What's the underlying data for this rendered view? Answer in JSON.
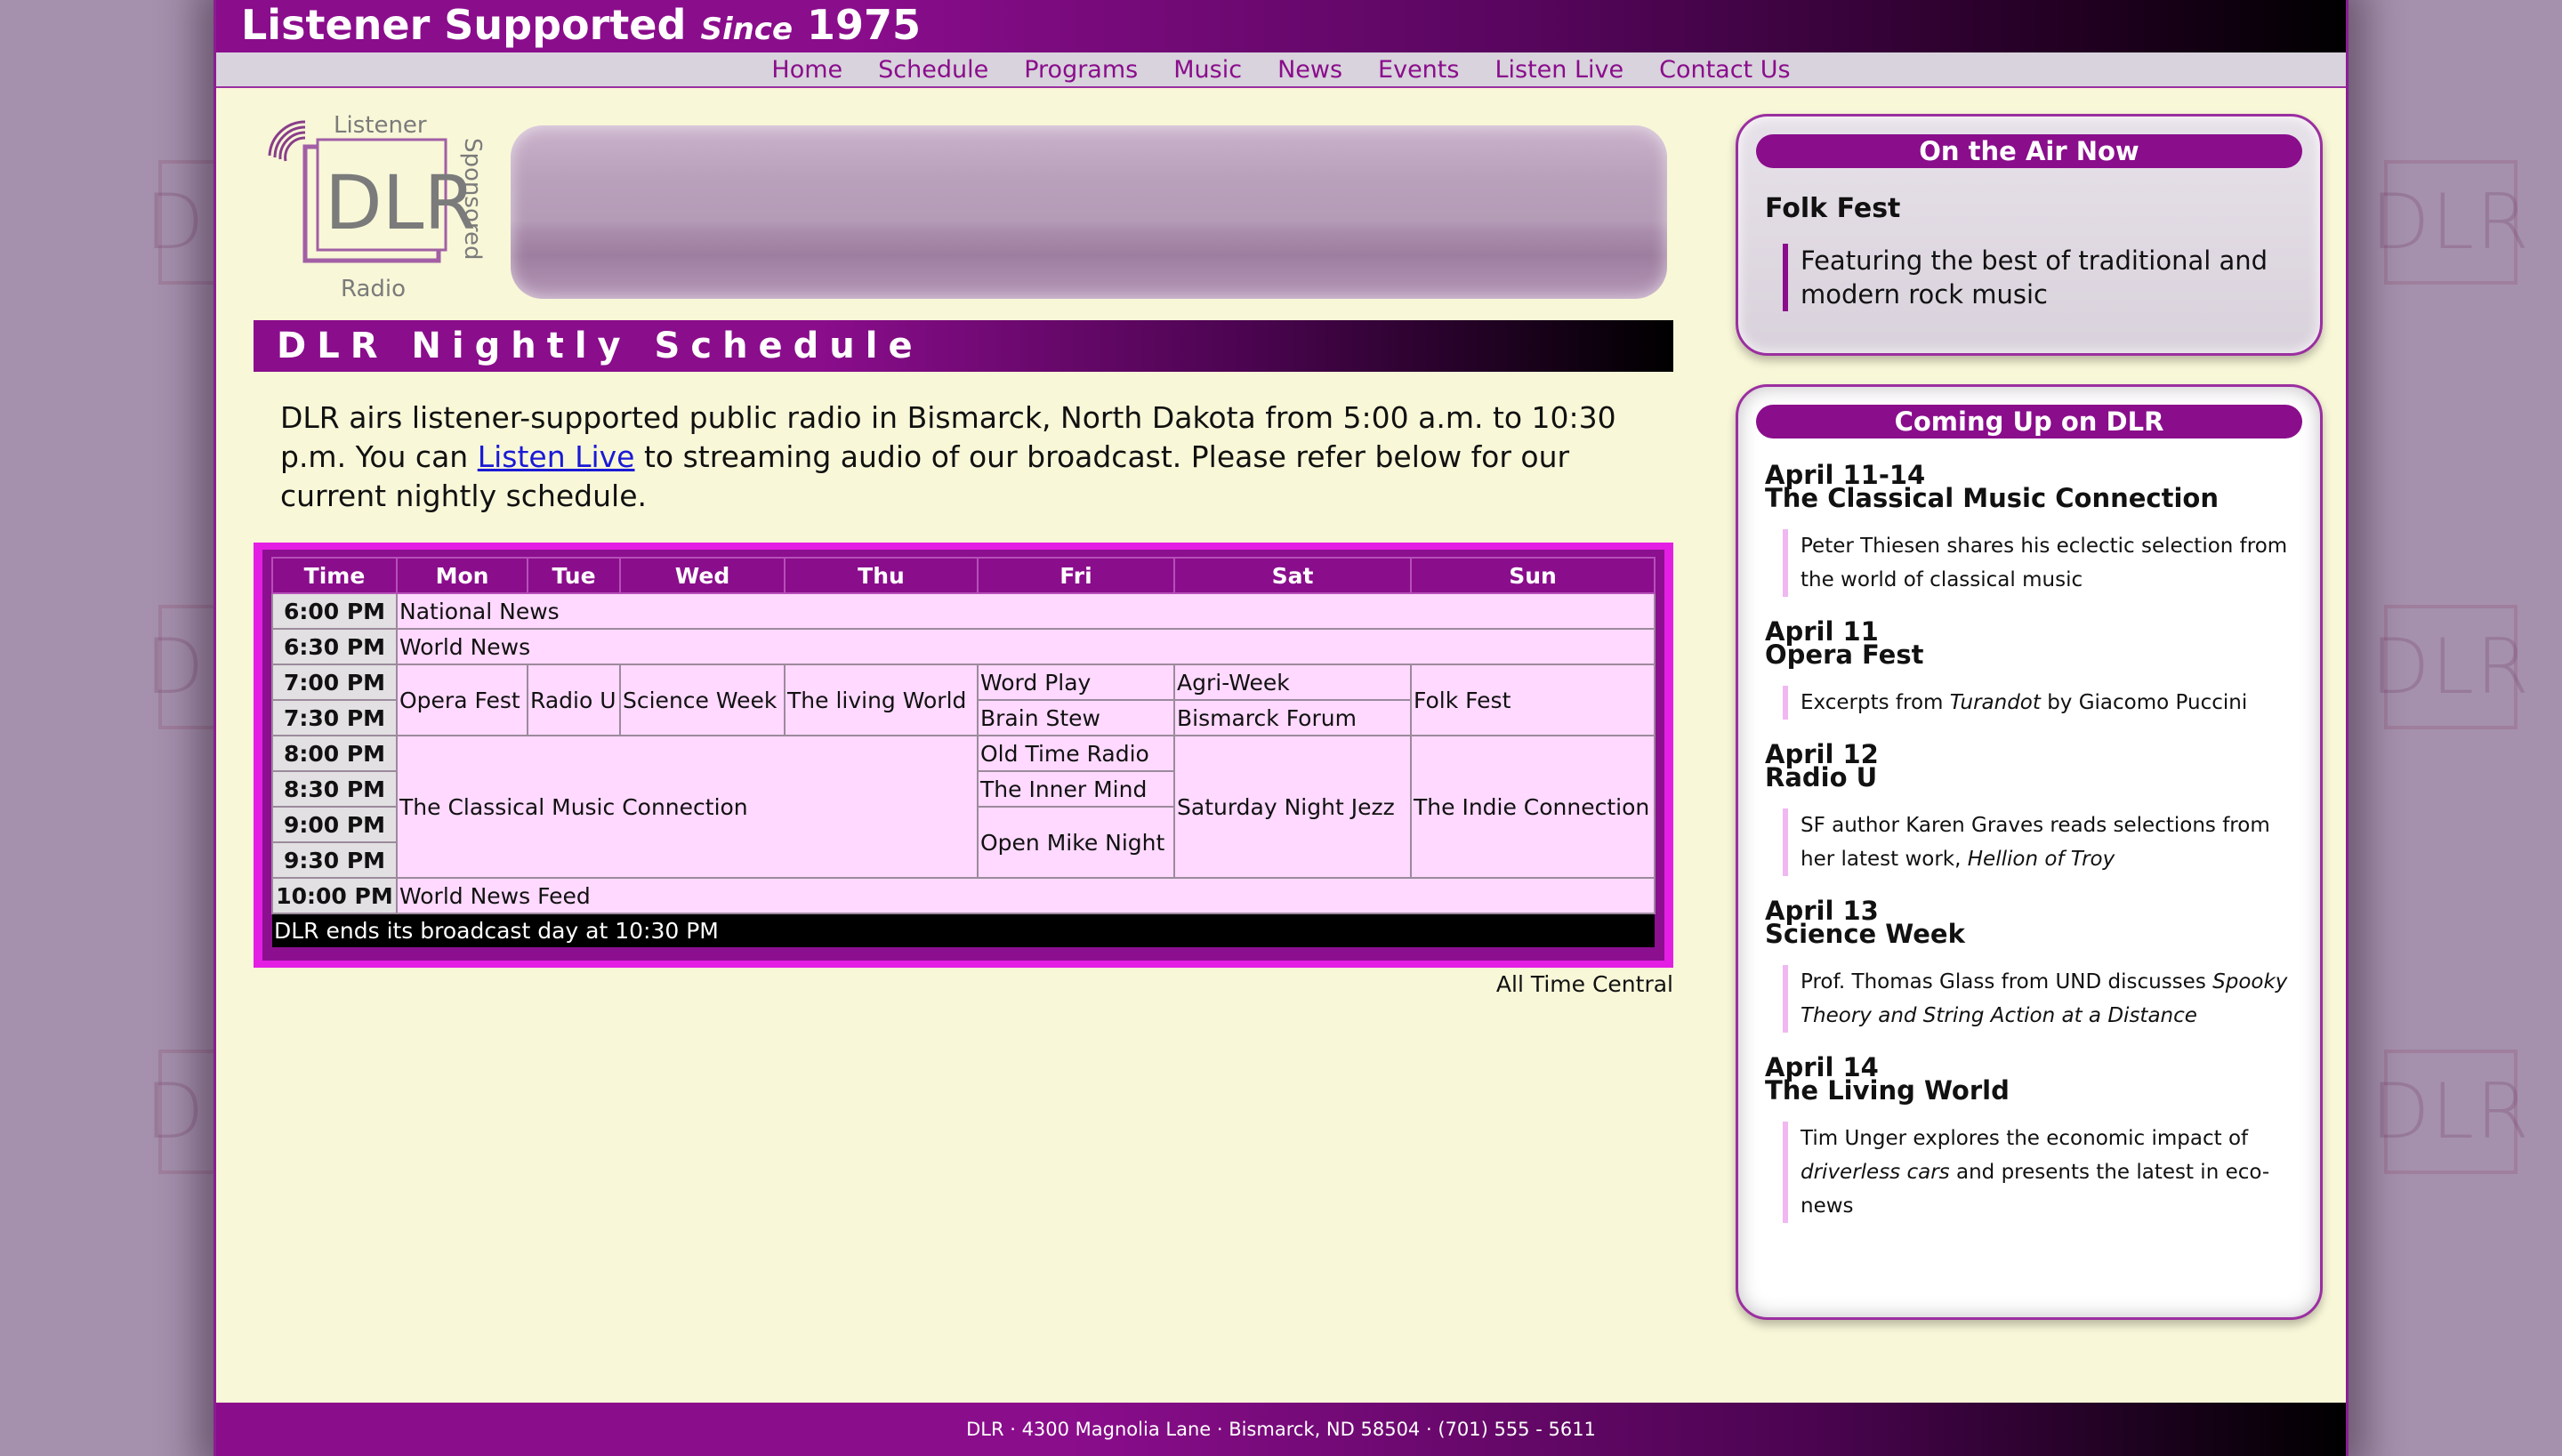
{
  "masthead": {
    "part1": "Listener Supported",
    "since": "Since",
    "year": "1975"
  },
  "nav": [
    "Home",
    "Schedule",
    "Programs",
    "Music",
    "News",
    "Events",
    "Listen Live",
    "Contact Us"
  ],
  "logo": {
    "listener": "Listener",
    "dlr": "DLR",
    "sponsored": "Sponsored",
    "radio": "Radio"
  },
  "schedule_title": "DLR Nightly Schedule",
  "intro": {
    "before": "DLR airs listener-supported public radio in Bismarck, North Dakota from 5:00 a.m. to 10:30 p.m. You can ",
    "link": "Listen Live",
    "after": " to streaming audio of our broadcast. Please refer below for our current nightly schedule."
  },
  "table": {
    "headers": [
      "Time",
      "Mon",
      "Tue",
      "Wed",
      "Thu",
      "Fri",
      "Sat",
      "Sun"
    ],
    "times": [
      "6:00 PM",
      "6:30 PM",
      "7:00 PM",
      "7:30 PM",
      "8:00 PM",
      "8:30 PM",
      "9:00 PM",
      "9:30 PM",
      "10:00 PM"
    ],
    "national_news": "National News",
    "world_news": "World News",
    "opera_fest": "Opera Fest",
    "radio_u": "Radio U",
    "science_week": "Science Week",
    "living_world": "The living World",
    "word_play": "Word Play",
    "agri_week": "Agri-Week",
    "folk_fest": "Folk Fest",
    "brain_stew": "Brain Stew",
    "bismarck_forum": "Bismarck Forum",
    "classical": "The Classical Music Connection",
    "old_time_radio": "Old Time Radio",
    "saturday_night": "Saturday Night Jezz",
    "indie": "The Indie Connection",
    "inner_mind": "The Inner Mind",
    "open_mike": "Open Mike Night",
    "world_news_feed": "World News Feed",
    "end_note": "DLR ends its broadcast day at 10:30 PM"
  },
  "all_time_central": "All Time Central",
  "on_air": {
    "heading": "On the Air Now",
    "show": "Folk Fest",
    "desc": "Featuring the best of traditional and modern rock music"
  },
  "coming_up": {
    "heading": "Coming Up on DLR",
    "events": [
      {
        "date": "April 11-14",
        "title": "The Classical Music Connection",
        "desc_pre": "Peter Thiesen shares his eclectic selection from the world of classical music",
        "desc_em": "",
        "desc_post": ""
      },
      {
        "date": "April 11",
        "title": "Opera Fest",
        "desc_pre": "Excerpts from ",
        "desc_em": "Turandot",
        "desc_post": " by Giacomo Puccini"
      },
      {
        "date": "April 12",
        "title": "Radio U",
        "desc_pre": "SF author Karen Graves reads selections from her latest work, ",
        "desc_em": "Hellion of Troy",
        "desc_post": ""
      },
      {
        "date": "April 13",
        "title": "Science Week",
        "desc_pre": "Prof. Thomas Glass from UND discusses ",
        "desc_em": "Spooky Theory and String Action at a Distance",
        "desc_post": ""
      },
      {
        "date": "April 14",
        "title": "The Living World",
        "desc_pre": "Tim Unger explores the economic impact of ",
        "desc_em": "driverless cars",
        "desc_post": " and presents the latest in eco-news"
      }
    ]
  },
  "footer": "DLR · 4300 Magnolia Lane · Bismarck, ND 58504 · (701) 555 - 5611",
  "colors": {
    "accent": "#8a0d8c",
    "page_bg": "#f8f7d8",
    "cell_bg": "#ffd9ff",
    "backdrop": "#a591ad"
  }
}
